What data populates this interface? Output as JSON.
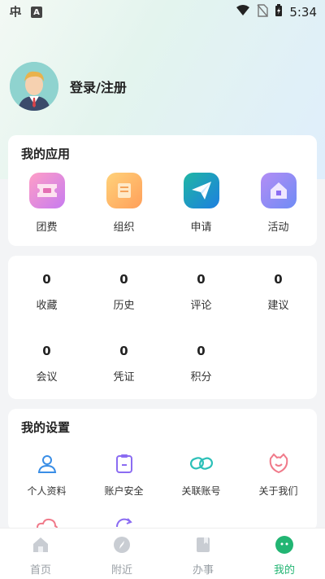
{
  "status_bar": {
    "time": "5:34",
    "left_icons": [
      "bug-icon",
      "a-badge-icon"
    ],
    "right_icons": [
      "wifi-icon",
      "no-sim-icon",
      "battery-charging-icon"
    ]
  },
  "profile": {
    "login_label": "登录/注册"
  },
  "apps": {
    "title": "我的应用",
    "items": [
      {
        "label": "团费",
        "icon": "ticket-icon"
      },
      {
        "label": "组织",
        "icon": "organization-icon"
      },
      {
        "label": "申请",
        "icon": "paper-plane-icon"
      },
      {
        "label": "活动",
        "icon": "house-icon"
      }
    ]
  },
  "stats": {
    "items": [
      {
        "value": "0",
        "label": "收藏"
      },
      {
        "value": "0",
        "label": "历史"
      },
      {
        "value": "0",
        "label": "评论"
      },
      {
        "value": "0",
        "label": "建议"
      },
      {
        "value": "0",
        "label": "会议"
      },
      {
        "value": "0",
        "label": "凭证"
      },
      {
        "value": "0",
        "label": "积分"
      }
    ]
  },
  "settings": {
    "title": "我的设置",
    "items": [
      {
        "label": "个人资料",
        "icon": "person-icon"
      },
      {
        "label": "账户安全",
        "icon": "clipboard-icon"
      },
      {
        "label": "关联账号",
        "icon": "link-icon"
      },
      {
        "label": "关于我们",
        "icon": "cat-face-icon"
      }
    ]
  },
  "tabbar": {
    "items": [
      {
        "label": "首页",
        "icon": "home-icon",
        "active": false
      },
      {
        "label": "附近",
        "icon": "compass-icon",
        "active": false
      },
      {
        "label": "办事",
        "icon": "book-icon",
        "active": false
      },
      {
        "label": "我的",
        "icon": "profile-face-icon",
        "active": true
      }
    ]
  },
  "colors": {
    "accent": "#22b573",
    "tab_inactive": "#9aa0a6",
    "icon_blue": "#3a8ee6",
    "icon_purple": "#8b6cf2",
    "icon_teal": "#2cc0b8",
    "icon_pink": "#f07a8a"
  }
}
